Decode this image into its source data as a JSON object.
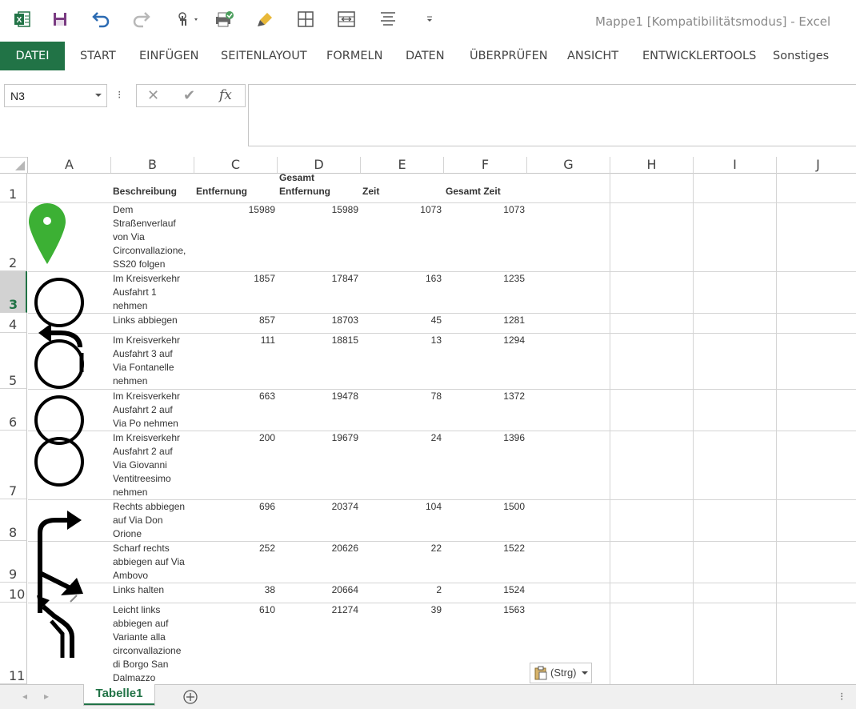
{
  "window": {
    "title": "Mappe1  [Kompatibilitätsmodus] - Excel"
  },
  "quick_access": {
    "icons": [
      "excel-logo",
      "save",
      "undo",
      "redo",
      "touch-mode",
      "print-preview",
      "format-painter",
      "borders",
      "merge-center",
      "align",
      "customize"
    ]
  },
  "ribbon": {
    "tabs": [
      "DATEI",
      "START",
      "EINFÜGEN",
      "SEITENLAYOUT",
      "FORMELN",
      "DATEN",
      "ÜBERPRÜFEN",
      "ANSICHT",
      "ENTWICKLERTOOLS",
      "Sonstiges"
    ]
  },
  "formula_bar": {
    "name_box": "N3",
    "fx_label": "fx",
    "formula": ""
  },
  "columns": [
    "A",
    "B",
    "C",
    "D",
    "E",
    "F",
    "G",
    "H",
    "I",
    "J"
  ],
  "rows": [
    "1",
    "2",
    "3",
    "4",
    "5",
    "6",
    "7",
    "8",
    "9",
    "10",
    "11"
  ],
  "selected_row": "3",
  "table": {
    "headers": {
      "b": "Beschreibung",
      "c": "Entfernung",
      "d_top": "Gesamt",
      "d_bottom": "Entfernung",
      "e": "Zeit",
      "f": "Gesamt Zeit"
    },
    "data": [
      {
        "b": [
          "Dem",
          "Straßenverlauf",
          "von Via",
          "Circonvallazione,",
          "SS20 folgen"
        ],
        "c": "15989",
        "d": "15989",
        "e": "1073",
        "f": "1073"
      },
      {
        "b": [
          "Im Kreisverkehr",
          "Ausfahrt 1",
          "nehmen"
        ],
        "c": "1857",
        "d": "17847",
        "e": "163",
        "f": "1235"
      },
      {
        "b": [
          "Links abbiegen"
        ],
        "c": "857",
        "d": "18703",
        "e": "45",
        "f": "1281"
      },
      {
        "b": [
          "Im Kreisverkehr",
          "Ausfahrt 3 auf",
          "Via Fontanelle",
          "nehmen"
        ],
        "c": "111",
        "d": "18815",
        "e": "13",
        "f": "1294"
      },
      {
        "b": [
          "Im Kreisverkehr",
          "Ausfahrt 2 auf",
          "Via Po nehmen"
        ],
        "c": "663",
        "d": "19478",
        "e": "78",
        "f": "1372"
      },
      {
        "b": [
          "Im Kreisverkehr",
          "Ausfahrt 2 auf",
          "Via Giovanni",
          "Ventitreesimo",
          "nehmen"
        ],
        "c": "200",
        "d": "19679",
        "e": "24",
        "f": "1396"
      },
      {
        "b": [
          "Rechts abbiegen",
          "auf Via Don",
          "Orione"
        ],
        "c": "696",
        "d": "20374",
        "e": "104",
        "f": "1500"
      },
      {
        "b": [
          "Scharf rechts",
          "abbiegen auf Via",
          "Ambovo"
        ],
        "c": "252",
        "d": "20626",
        "e": "22",
        "f": "1522"
      },
      {
        "b": [
          "Links halten"
        ],
        "c": "38",
        "d": "20664",
        "e": "2",
        "f": "1524"
      },
      {
        "b": [
          "Leicht links",
          "abbiegen auf",
          "Variante alla",
          "circonvallazione",
          "di Borgo San",
          "Dalmazzo"
        ],
        "c": "610",
        "d": "21274",
        "e": "39",
        "f": "1563"
      }
    ]
  },
  "paste_options": {
    "label": "(Strg)"
  },
  "sheets": {
    "active": "Tabelle1"
  },
  "colors": {
    "excel_green": "#217346",
    "marker_green": "#3cb034"
  }
}
